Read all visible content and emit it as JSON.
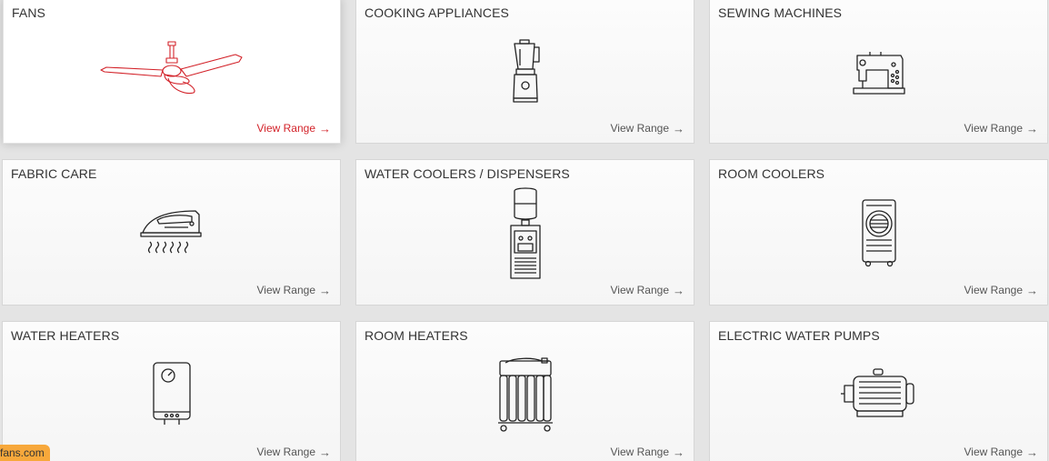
{
  "link_label": "View Range",
  "link_arrow": "→",
  "accent_color": "#d3232a",
  "categories": [
    {
      "title": "FANS",
      "icon": "ceiling-fan-icon",
      "active": true
    },
    {
      "title": "COOKING APPLIANCES",
      "icon": "blender-icon"
    },
    {
      "title": "SEWING MACHINES",
      "icon": "sewing-machine-icon"
    },
    {
      "title": "FABRIC CARE",
      "icon": "iron-icon"
    },
    {
      "title": "WATER COOLERS / DISPENSERS",
      "icon": "water-dispenser-icon"
    },
    {
      "title": "ROOM COOLERS",
      "icon": "air-cooler-icon"
    },
    {
      "title": "WATER HEATERS",
      "icon": "water-heater-icon"
    },
    {
      "title": "ROOM HEATERS",
      "icon": "oil-heater-icon"
    },
    {
      "title": "ELECTRIC WATER PUMPS",
      "icon": "water-pump-icon"
    }
  ],
  "corner_tag": "fans.com"
}
